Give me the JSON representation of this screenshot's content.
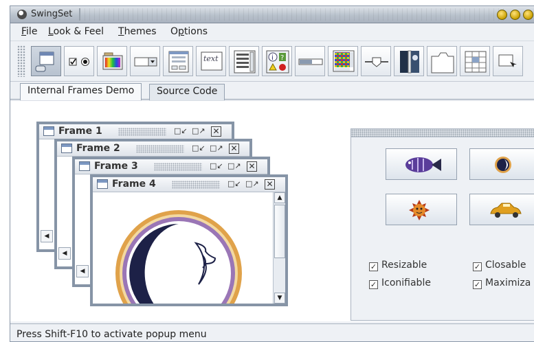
{
  "window": {
    "title": "SwingSet"
  },
  "menubar": {
    "items": [
      {
        "mnemonic": "F",
        "rest": "ile"
      },
      {
        "mnemonic": "L",
        "rest": "ook & Feel"
      },
      {
        "mnemonic": "T",
        "rest": "hemes"
      },
      {
        "prefix": "O",
        "mnemonic": "p",
        "rest": "tions"
      }
    ]
  },
  "toolbar": {
    "text_button_label": "text"
  },
  "tabs": [
    {
      "label": "Internal Frames Demo"
    },
    {
      "label": "Source Code"
    }
  ],
  "frames": [
    {
      "title": "Frame 1"
    },
    {
      "title": "Frame 2"
    },
    {
      "title": "Frame 3"
    },
    {
      "title": "Frame 4"
    }
  ],
  "options": {
    "resizable": {
      "label": "Resizable",
      "checked": true
    },
    "closable": {
      "label": "Closable",
      "checked": true
    },
    "iconifiable": {
      "label": "Iconifiable",
      "checked": true
    },
    "maximizable": {
      "label": "Maximiza",
      "checked": true
    }
  },
  "status": {
    "text": "Press Shift-F10 to activate popup menu"
  },
  "colors": {
    "frame_border": "#8694a6",
    "window_bg": "#eef1f5",
    "tab_border": "#95a1b0"
  }
}
